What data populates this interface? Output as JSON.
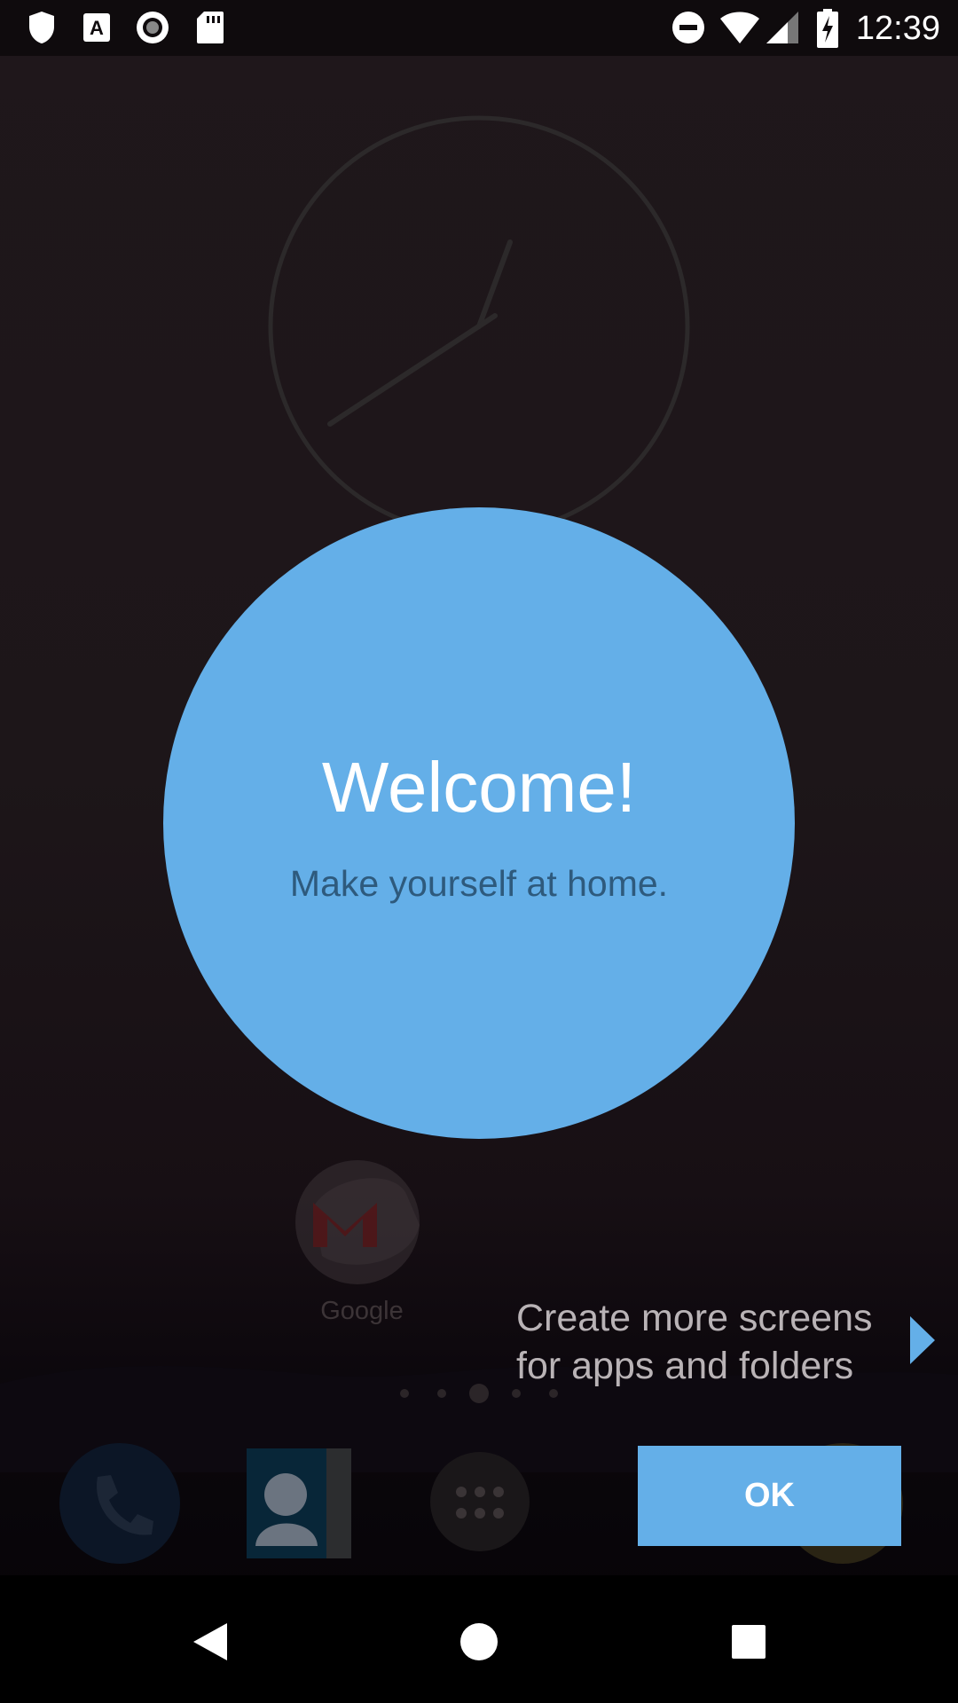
{
  "status_bar": {
    "time": "12:39",
    "left_icons": [
      "shield-icon",
      "font-icon",
      "record-icon",
      "sd-card-icon"
    ],
    "right_icons": [
      "do-not-disturb-icon",
      "wifi-icon",
      "cell-signal-icon",
      "battery-charging-icon"
    ]
  },
  "home": {
    "app_label": "Google",
    "dock_icons": [
      "phone-icon",
      "contacts-icon",
      "app-drawer-icon",
      "chrome-icon"
    ]
  },
  "onboarding": {
    "title": "Welcome!",
    "subtitle": "Make yourself at home.",
    "hint_line1": "Create more screens",
    "hint_line2": "for apps and folders",
    "ok_label": "OK"
  },
  "nav_bar": {
    "icons": [
      "back-icon",
      "home-icon",
      "recents-icon"
    ]
  },
  "colors": {
    "accent": "#64afe8",
    "subtitle": "#2e5a7d",
    "hint_text": "#b9b3b6"
  }
}
